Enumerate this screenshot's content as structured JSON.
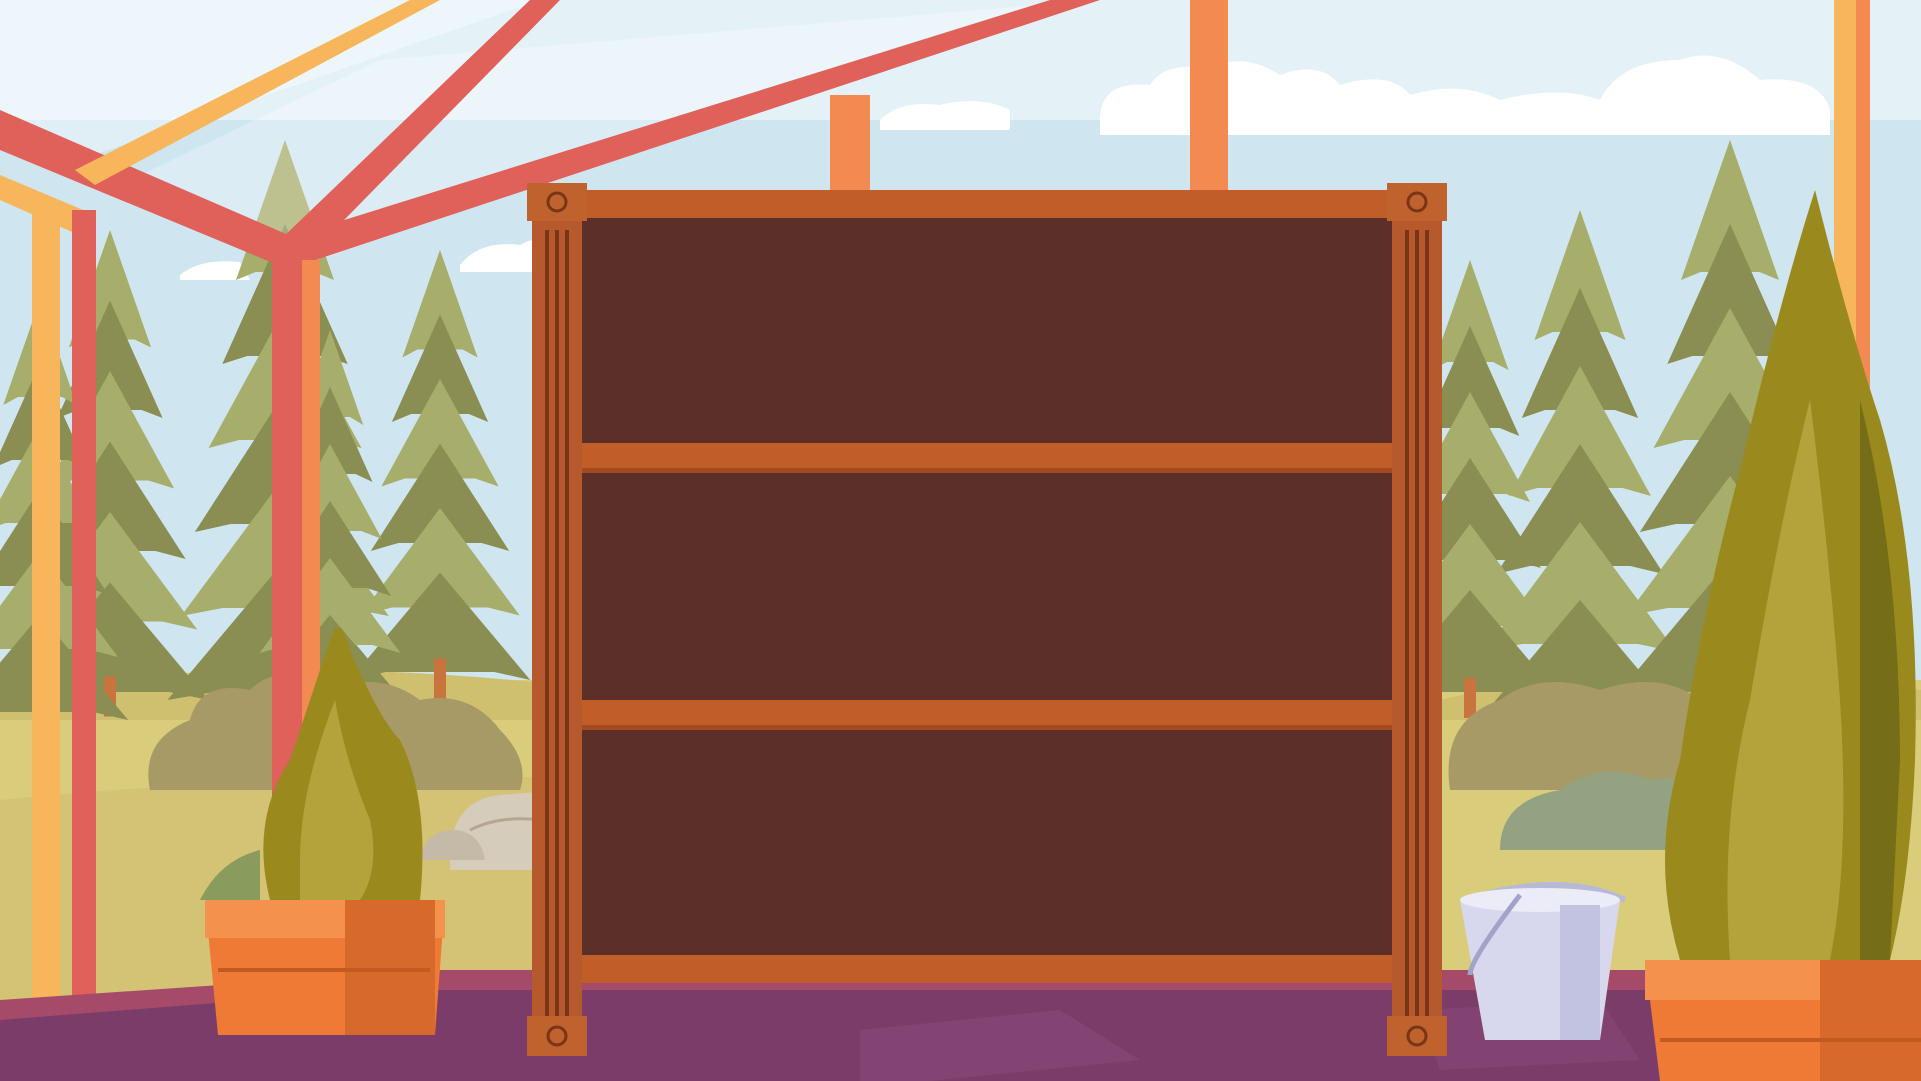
{
  "scene": {
    "kind": "greenhouse-interior-with-empty-shelf",
    "shelf": {
      "shelf_count": 3,
      "slots": [
        {
          "label": "top-shelf",
          "items": []
        },
        {
          "label": "middle-shelf",
          "items": []
        },
        {
          "label": "bottom-shelf",
          "items": []
        }
      ]
    },
    "props": [
      "potted-shrub-left",
      "potted-cypress-right",
      "metal-bucket",
      "boulders"
    ],
    "colors": {
      "sky": "#cfe6f0",
      "cloud": "#ffffff",
      "pine": "#a7ad6a",
      "pine_dark": "#8a8e52",
      "meadow": "#d9cc7a",
      "bush": "#a89a66",
      "frame_pink": "#e0605a",
      "frame_orange": "#f28a52",
      "frame_yellow": "#f7b65b",
      "floor": "#7b3c6a",
      "floor_edge": "#a64a6a",
      "shelf_frame": "#c05d28",
      "shelf_pillar": "#b65a2d",
      "shelf_panel": "#5c3029",
      "pot": "#ee7a35",
      "shrub": "#9a8a1e",
      "bucket": "#d7d8ee"
    }
  }
}
